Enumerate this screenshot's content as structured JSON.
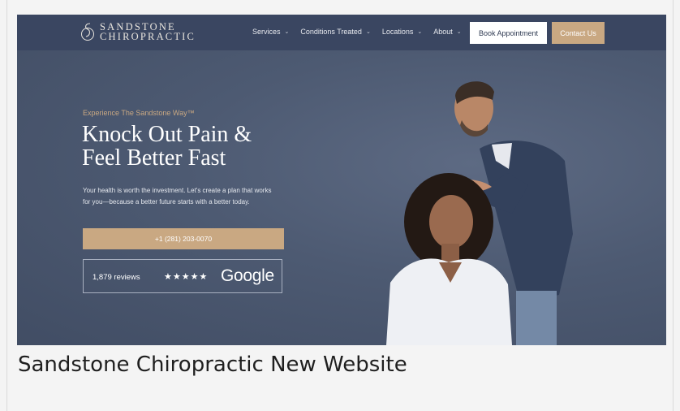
{
  "header": {
    "logo": {
      "line1": "SANDSTONE",
      "line2": "CHIROPRACTIC",
      "icon": "sandstone-s-logo-icon"
    },
    "nav": [
      {
        "label": "Services",
        "icon": "chevron-down-icon"
      },
      {
        "label": "Conditions Treated",
        "icon": "chevron-down-icon"
      },
      {
        "label": "Locations",
        "icon": "chevron-down-icon"
      },
      {
        "label": "About",
        "icon": "chevron-down-icon"
      }
    ],
    "book_label": "Book Appointment",
    "contact_label": "Contact Us"
  },
  "hero": {
    "eyebrow": "Experience The Sandstone Way™",
    "headline_line1": "Knock Out Pain &",
    "headline_line2": "Feel Better Fast",
    "subtext": "Your health is worth the investment. Let's create a plan that works for you—because a better future starts with a better today.",
    "phone": "+1 (281) 203-0070",
    "reviews": {
      "count": "1,879 reviews",
      "stars": "★★★★★",
      "provider": "Google"
    }
  },
  "caption": "Sandstone Chiropractic New Website",
  "colors": {
    "navy": "#3a4661",
    "hero_bg": "#4d5a72",
    "gold": "#c9a882",
    "white": "#ffffff"
  }
}
